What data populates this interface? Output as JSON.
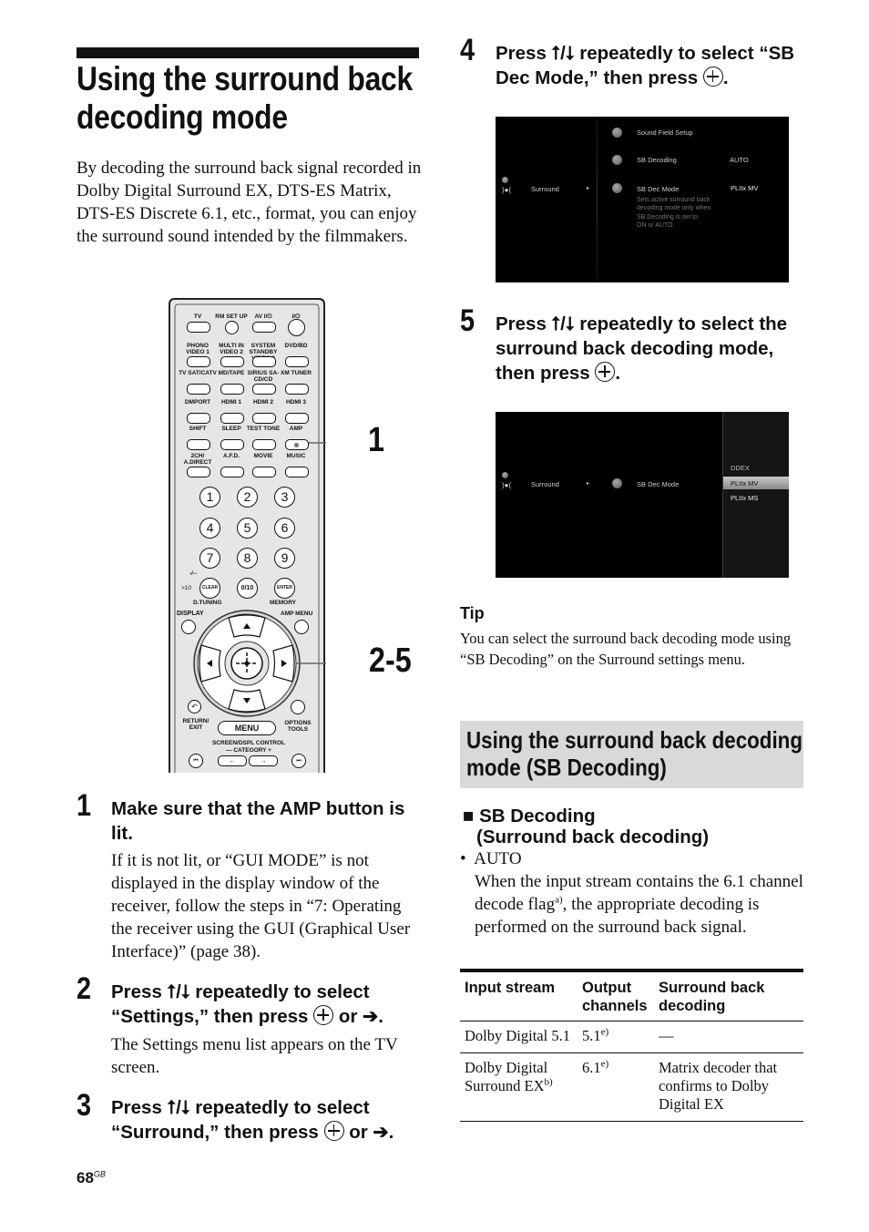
{
  "page": {
    "title": "Using the surround back decoding mode",
    "intro": "By decoding the surround back signal recorded in Dolby Digital Surround EX, DTS-ES Matrix, DTS-ES Discrete 6.1, etc., format, you can enjoy the surround sound intended by the filmmakers.",
    "page_number": "68",
    "page_suffix": "GB"
  },
  "remote": {
    "callouts": [
      "1",
      "2-5"
    ],
    "rows": [
      [
        "TV",
        "RM SET UP",
        "AV I/⏻",
        "I/⏻"
      ],
      [
        "PHONO VIDEO 1",
        "MULTI IN VIDEO 2",
        "SYSTEM STANDBY VIDEO 3",
        "DVD/BD"
      ],
      [
        "TV SAT/CATV",
        "MD/TAPE",
        "SIRIUS SA-CD/CD",
        "XM TUNER"
      ],
      [
        "DMPORT",
        "HDMI 1",
        "HDMI 2",
        "HDMI 3"
      ],
      [
        "SHIFT",
        "SLEEP",
        "TEST TONE",
        "AMP"
      ],
      [
        "2CH/ A.DIRECT",
        "A.F.D.",
        "MOVIE",
        "MUSIC"
      ]
    ],
    "numpad": [
      "1",
      "2",
      "3",
      "4",
      "5",
      "6",
      "7",
      "8",
      "9",
      "CLEAR",
      "0/10",
      "ENTER"
    ],
    "labels": {
      "ten_plus": ">10",
      "dash": "-/--",
      "d_tuning": "D.TUNING",
      "memory": "MEMORY",
      "display": "DISPLAY",
      "amp_menu": "AMP MENU",
      "return_exit": "RETURN/ EXIT",
      "menu": "MENU",
      "options_tools": "OPTIONS TOOLS",
      "screen_dspl": "SCREEN/DSPL CONTROL",
      "category": "— CATEGORY +"
    }
  },
  "steps": [
    {
      "num": "1",
      "head": "Make sure that the AMP button is lit.",
      "body": "If it is not lit, or “GUI MODE” is not displayed in the display window of the receiver, follow the steps in “7: Operating the receiver using the GUI (Graphical User Interface)” (page 38)."
    },
    {
      "num": "2",
      "head_a": "Press ⭡/⭣ repeatedly to select “Settings,” then press",
      "head_b": "or ➔.",
      "body": "The Settings menu list appears on the TV screen."
    },
    {
      "num": "3",
      "head_a": "Press ⭡/⭣ repeatedly to select “Surround,” then press",
      "head_b": "or ➔."
    },
    {
      "num": "4",
      "head_a": "Press ⭡/⭣ repeatedly to select “SB Dec Mode,” then press",
      "head_b": "."
    },
    {
      "num": "5",
      "head_a": "Press ⭡/⭣ repeatedly to select the surround back decoding mode, then press",
      "head_b": "."
    }
  ],
  "screen1": {
    "left_item": "Surround",
    "arrow": "▸",
    "menu": [
      {
        "label": "Sound Field Setup",
        "value": ""
      },
      {
        "label": "SB Decoding",
        "value": "AUTO"
      },
      {
        "label": "SB Dec Mode",
        "value": "PLIIx MV"
      }
    ],
    "help": [
      "Sets active surround back",
      "decoding mode only when",
      "SB Decoding is set to",
      "ON or AUTO."
    ]
  },
  "screen2": {
    "left_item": "Surround",
    "arrow": "▸",
    "menu_item": "SB Dec Mode",
    "options": [
      "DDEX",
      "PLIIx MV",
      "PLIIx MS"
    ],
    "selected": "PLIIx MV"
  },
  "tip": {
    "head": "Tip",
    "body": "You can select the surround back decoding mode using “SB Decoding” on the Surround settings menu."
  },
  "section": {
    "title": "Using the surround back decoding mode (SB Decoding)",
    "subhead_marker": "■",
    "subhead": "SB Decoding",
    "subhead2": "(Surround back decoding)",
    "bullet": "•",
    "bullet_label": "AUTO",
    "body_a": "When the input stream contains the 6.1 channel decode flag",
    "body_sup": "a)",
    "body_b": ", the appropriate decoding is performed on the surround back signal."
  },
  "table": {
    "headers": [
      "Input stream",
      "Output channels",
      "Surround back decoding"
    ],
    "rows": [
      {
        "input": "Dolby Digital 5.1",
        "input_sup": "",
        "output": "5.1",
        "output_sup": "e)",
        "decoding": "—"
      },
      {
        "input": "Dolby Digital Surround EX",
        "input_sup": "b)",
        "output": "6.1",
        "output_sup": "e)",
        "decoding": "Matrix decoder that confirms to Dolby Digital EX"
      }
    ]
  }
}
